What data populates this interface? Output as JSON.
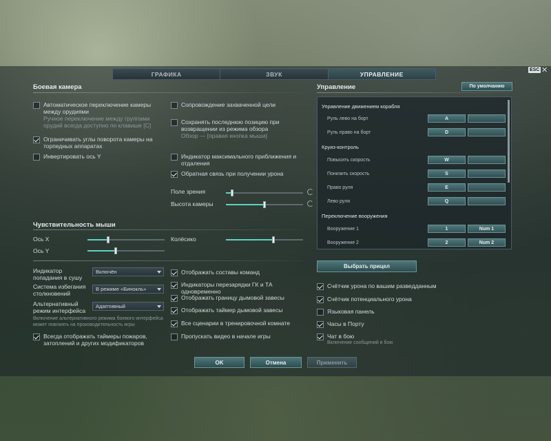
{
  "tabs": [
    {
      "label": "ГРАФИКА",
      "active": false
    },
    {
      "label": "ЗВУК",
      "active": false
    },
    {
      "label": "УПРАВЛЕНИЕ",
      "active": true
    }
  ],
  "esc_label": "ESC",
  "close_icon": "close-icon",
  "battle_camera": {
    "title": "Боевая камера",
    "auto_switch": {
      "label": "Автоматическое переключение камеры между орудиями",
      "sub": "Ручное переключение между группами орудий всегда доступно по клавише [C]",
      "checked": false
    },
    "limit_angles": {
      "label": "Ограничивать углы поворота камеры на торпедных аппаратах",
      "checked": true
    },
    "invert_y": {
      "label": "Инвертировать ось Y",
      "checked": false
    },
    "track_target": {
      "label": "Сопровождение захваченной цели",
      "checked": false
    },
    "save_position": {
      "label": "Сохранять последнюю позицию при возвращении из режима обзора",
      "sub": "Обзор — [правая кнопка мыши]",
      "checked": false
    },
    "zoom_indicator": {
      "label": "Индикатор максимального приближения и отдаления",
      "checked": false
    },
    "damage_feedback": {
      "label": "Обратная связь при получении урона",
      "checked": true
    },
    "fov": {
      "label": "Поле зрения",
      "value": 0.08
    },
    "camera_height": {
      "label": "Высота камеры",
      "value": 0.5
    }
  },
  "mouse_sensitivity": {
    "title": "Чувствительность мыши",
    "axis_x": {
      "label": "Ось X",
      "value": 0.27
    },
    "axis_y": {
      "label": "Ось Y",
      "value": 0.37
    },
    "wheel": {
      "label": "Колёсико",
      "value": 0.62
    }
  },
  "interface": {
    "hit_indicator": {
      "label": "Индикатор попадания в сушу",
      "value": "Включён"
    },
    "collision_system": {
      "label": "Система избегания столкновений",
      "value": "В режиме «Бинокль»"
    },
    "alt_interface": {
      "label": "Альтернативный режим интерфейса",
      "value": "Адаптивный",
      "note": "Включение альтернативного режима боевого интерфейса может повлиять на производительность игры"
    },
    "show_timers": {
      "label": "Всегда отображать таймеры пожаров, затоплений и других модификаторов",
      "checked": true
    },
    "show_teams": {
      "label": "Отображать составы команд",
      "checked": true
    },
    "reload_indicators": {
      "label": "Индикаторы перезарядки ГК и ТА одновременно",
      "checked": true
    },
    "smoke_border": {
      "label": "Отображать границу дымовой завесы",
      "checked": true
    },
    "smoke_timer": {
      "label": "Отображать таймер дымовой завесы",
      "checked": true
    },
    "all_scenarios": {
      "label": "Все сценарии в тренировочной комнате",
      "checked": true
    },
    "skip_video": {
      "label": "Пропускать видео в начале игры",
      "checked": false
    }
  },
  "controls": {
    "title": "Управление",
    "default_button": "По умолчанию",
    "groups": [
      {
        "header": "Управление движением корабля",
        "rows": [
          {
            "label": "Руль лево на борт",
            "key1": "A",
            "key2": ""
          },
          {
            "label": "Руль право на борт",
            "key1": "D",
            "key2": ""
          }
        ]
      },
      {
        "header": "Круиз-контроль",
        "rows": [
          {
            "label": "Повысить скорость",
            "key1": "W",
            "key2": ""
          },
          {
            "label": "Понизить скорость",
            "key1": "S",
            "key2": ""
          },
          {
            "label": "Право руля",
            "key1": "E",
            "key2": ""
          },
          {
            "label": "Лево руля",
            "key1": "Q",
            "key2": ""
          }
        ]
      },
      {
        "header": "Переключение вооружения",
        "rows": [
          {
            "label": "Вооружение 1",
            "key1": "1",
            "key2": "Num 1"
          },
          {
            "label": "Вооружение 2",
            "key1": "2",
            "key2": "Num 2"
          }
        ]
      }
    ],
    "select_sight": "Выбрать прицел",
    "damage_counter": {
      "label": "Счётчик урона по вашим разведданным",
      "checked": true
    },
    "potential_damage": {
      "label": "Счётчик потенциального урона",
      "checked": true
    },
    "language_panel": {
      "label": "Языковая панель",
      "checked": false
    },
    "port_clock": {
      "label": "Часы в Порту",
      "checked": true
    },
    "battle_chat": {
      "label": "Чат в бою",
      "sub": "Включение сообщений в бою",
      "checked": true
    }
  },
  "footer": {
    "ok": "OK",
    "cancel": "Отмена",
    "apply": "Применить"
  },
  "colors": {
    "accent": "#5fd4c0",
    "button": "#3e6366"
  }
}
